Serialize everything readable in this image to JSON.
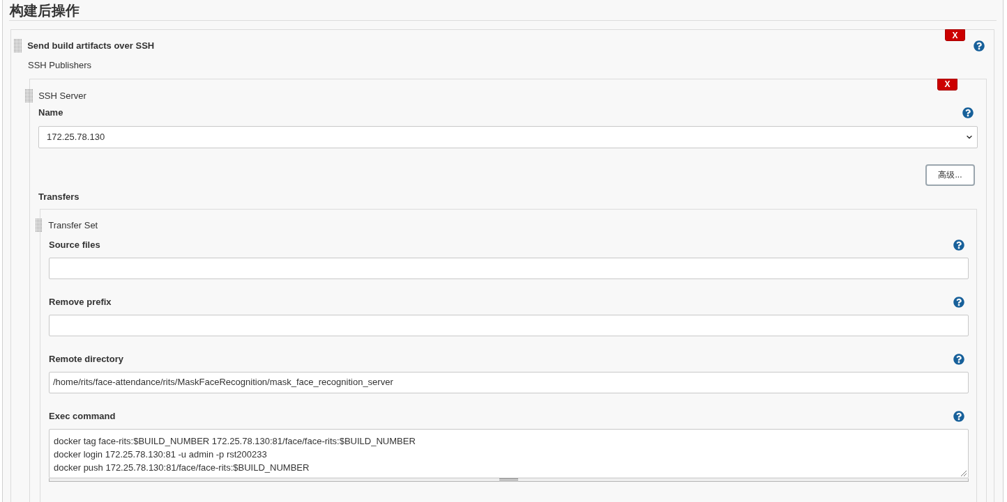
{
  "section": {
    "title": "构建后操作"
  },
  "publisher": {
    "title": "Send build artifacts over SSH",
    "delete_label": "X",
    "subtitle": "SSH Publishers",
    "server": {
      "title": "SSH Server",
      "delete_label": "X",
      "name_field": {
        "label": "Name",
        "value": "172.25.78.130"
      },
      "advanced_button": "高级...",
      "transfers_label": "Transfers",
      "transfer_set": {
        "title": "Transfer Set",
        "fields": [
          {
            "kind": "text",
            "label": "Source files"
          },
          {
            "kind": "text",
            "label": "Remove prefix"
          },
          {
            "kind": "text",
            "label": "Remote directory",
            "value": "/home/rits/face-attendance/rits/MaskFaceRecognition/mask_face_recognition_server"
          },
          {
            "kind": "textarea",
            "label": "Exec command",
            "lines": [
              "docker tag face-rits:$BUILD_NUMBER 172.25.78.130:81/face/face-rits:$BUILD_NUMBER",
              "docker login 172.25.78.130:81 -u admin -p rst200233",
              "docker push 172.25.78.130:81/face/face-rits:$BUILD_NUMBER"
            ]
          }
        ]
      }
    }
  }
}
